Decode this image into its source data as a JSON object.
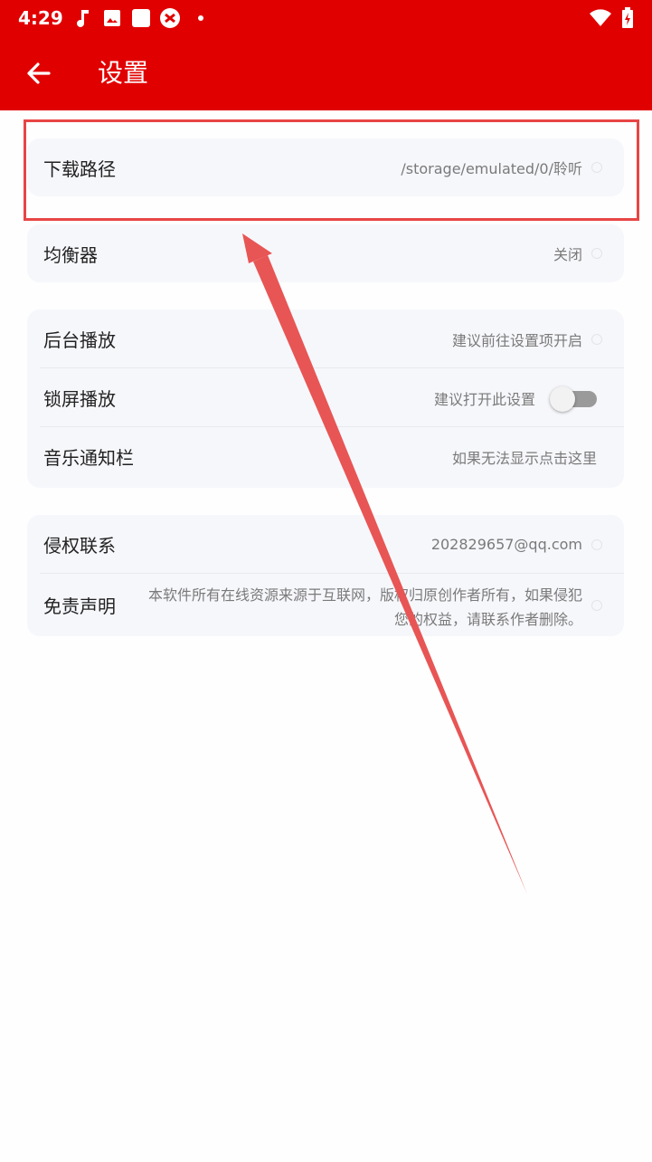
{
  "status_bar": {
    "time": "4:29",
    "icons": [
      "music-note-icon",
      "image-icon",
      "square-icon",
      "app-icon",
      "dot-icon",
      "wifi-icon",
      "battery-charging-icon"
    ]
  },
  "app_bar": {
    "title": "设置",
    "back_icon": "arrow-left-icon"
  },
  "colors": {
    "primary": "#e10000",
    "card_bg": "#f6f7fb",
    "annotation": "#e84545"
  },
  "cards": {
    "download": {
      "label": "下载路径",
      "value": "/storage/emulated/0/聆听"
    },
    "equalizer": {
      "label": "均衡器",
      "value": "关闭"
    },
    "playback": {
      "background": {
        "label": "后台播放",
        "value": "建议前往设置项开启"
      },
      "lockscreen": {
        "label": "锁屏播放",
        "value": "建议打开此设置",
        "toggle_on": false
      },
      "notification": {
        "label": "音乐通知栏",
        "value": "如果无法显示点击这里"
      }
    },
    "legal": {
      "contact": {
        "label": "侵权联系",
        "value": "202829657@qq.com"
      },
      "disclaimer": {
        "label": "免责声明",
        "value": "本软件所有在线资源来源于互联网，版权归原创作者所有，如果侵犯您的权益，请联系作者删除。"
      }
    }
  }
}
